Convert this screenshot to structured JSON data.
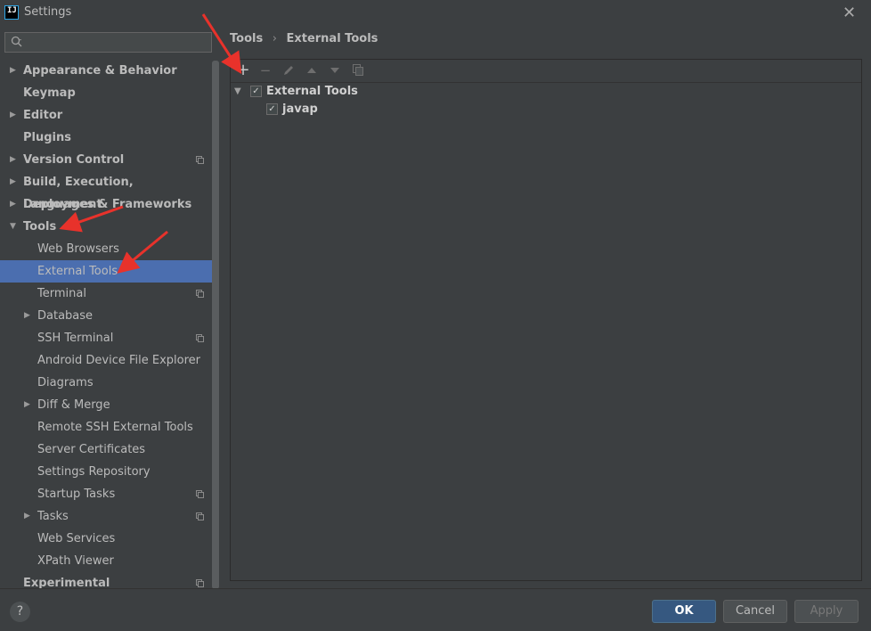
{
  "window": {
    "title": "Settings",
    "app_icon_text": "IJ"
  },
  "search": {
    "placeholder": "",
    "value": ""
  },
  "sidebar": {
    "items": [
      {
        "label": "Appearance & Behavior",
        "level": 0,
        "bold": true,
        "expander": "collapsed",
        "copy": false
      },
      {
        "label": "Keymap",
        "level": 0,
        "bold": true,
        "expander": "none",
        "copy": false
      },
      {
        "label": "Editor",
        "level": 0,
        "bold": true,
        "expander": "collapsed",
        "copy": false
      },
      {
        "label": "Plugins",
        "level": 0,
        "bold": true,
        "expander": "none",
        "copy": false
      },
      {
        "label": "Version Control",
        "level": 0,
        "bold": true,
        "expander": "collapsed",
        "copy": true
      },
      {
        "label": "Build, Execution, Deployment",
        "level": 0,
        "bold": true,
        "expander": "collapsed",
        "copy": false
      },
      {
        "label": "Languages & Frameworks",
        "level": 0,
        "bold": true,
        "expander": "collapsed",
        "copy": false
      },
      {
        "label": "Tools",
        "level": 0,
        "bold": true,
        "expander": "expanded",
        "copy": false
      },
      {
        "label": "Web Browsers",
        "level": 1,
        "bold": false,
        "expander": "none",
        "copy": false
      },
      {
        "label": "External Tools",
        "level": 1,
        "bold": false,
        "expander": "none",
        "copy": false,
        "selected": true
      },
      {
        "label": "Terminal",
        "level": 1,
        "bold": false,
        "expander": "none",
        "copy": true
      },
      {
        "label": "Database",
        "level": 1,
        "bold": false,
        "expander": "collapsed",
        "copy": false
      },
      {
        "label": "SSH Terminal",
        "level": 1,
        "bold": false,
        "expander": "none",
        "copy": true
      },
      {
        "label": "Android Device File Explorer",
        "level": 1,
        "bold": false,
        "expander": "none",
        "copy": false
      },
      {
        "label": "Diagrams",
        "level": 1,
        "bold": false,
        "expander": "none",
        "copy": false
      },
      {
        "label": "Diff & Merge",
        "level": 1,
        "bold": false,
        "expander": "collapsed",
        "copy": false
      },
      {
        "label": "Remote SSH External Tools",
        "level": 1,
        "bold": false,
        "expander": "none",
        "copy": false
      },
      {
        "label": "Server Certificates",
        "level": 1,
        "bold": false,
        "expander": "none",
        "copy": false
      },
      {
        "label": "Settings Repository",
        "level": 1,
        "bold": false,
        "expander": "none",
        "copy": false
      },
      {
        "label": "Startup Tasks",
        "level": 1,
        "bold": false,
        "expander": "none",
        "copy": true
      },
      {
        "label": "Tasks",
        "level": 1,
        "bold": false,
        "expander": "collapsed",
        "copy": true
      },
      {
        "label": "Web Services",
        "level": 1,
        "bold": false,
        "expander": "none",
        "copy": false
      },
      {
        "label": "XPath Viewer",
        "level": 1,
        "bold": false,
        "expander": "none",
        "copy": false
      },
      {
        "label": "Experimental",
        "level": 0,
        "bold": true,
        "expander": "none",
        "copy": true
      }
    ]
  },
  "breadcrumb": {
    "parts": [
      "Tools",
      "External Tools"
    ],
    "separator": "›"
  },
  "toolbar": {
    "icons": [
      "plus-icon",
      "minus-icon",
      "pencil-icon",
      "arrow-up-icon",
      "arrow-down-icon",
      "copy-icon"
    ]
  },
  "tree": {
    "group": {
      "label": "External Tools",
      "checked": true,
      "expanded": true
    },
    "children": [
      {
        "label": "javap",
        "checked": true
      }
    ]
  },
  "buttons": {
    "ok": "OK",
    "cancel": "Cancel",
    "apply": "Apply",
    "help": "?"
  },
  "colors": {
    "selection": "#4b6eaf",
    "ok_button": "#365880",
    "annotation_arrow": "#e8322b"
  }
}
